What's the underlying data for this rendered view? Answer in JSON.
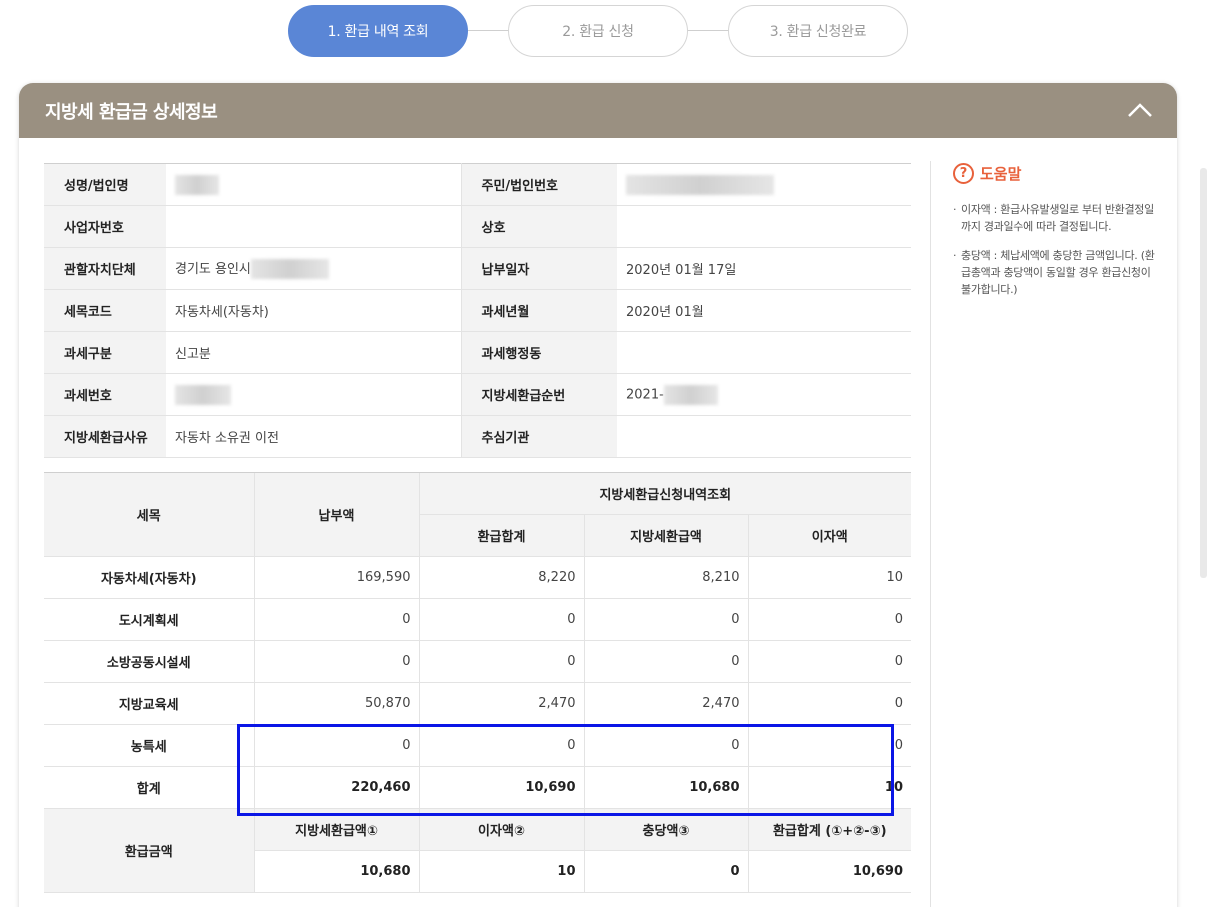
{
  "steps": [
    {
      "label": "1. 환급 내역 조회"
    },
    {
      "label": "2. 환급 신청"
    },
    {
      "label": "3. 환급 신청완료"
    }
  ],
  "panel": {
    "title": "지방세 환급금 상세정보"
  },
  "info": {
    "r1": {
      "l1": "성명/법인명",
      "l2": "주민/법인번호"
    },
    "r2": {
      "l1": "사업자번호",
      "l2": "상호"
    },
    "r3": {
      "l1": "관할자치단체",
      "v1": "경기도 용인시",
      "l2": "납부일자",
      "v2": "2020년 01월 17일"
    },
    "r4": {
      "l1": "세목코드",
      "v1": "자동차세(자동차)",
      "l2": "과세년월",
      "v2": "2020년 01월"
    },
    "r5": {
      "l1": "과세구분",
      "v1": "신고분",
      "l2": "과세행정동"
    },
    "r6": {
      "l1": "과세번호",
      "l2": "지방세환급순번",
      "v2": "2021-"
    },
    "r7": {
      "l1": "지방세환급사유",
      "v1": "자동차 소유권 이전",
      "l2": "추심기관"
    }
  },
  "amounts": {
    "h_item": "세목",
    "h_paid": "납부액",
    "h_group": "지방세환급신청내역조회",
    "h_total": "환급합계",
    "h_local": "지방세환급액",
    "h_interest": "이자액",
    "rows": [
      {
        "name": "자동차세(자동차)",
        "paid": "169,590",
        "total": "8,220",
        "local": "8,210",
        "interest": "10"
      },
      {
        "name": "도시계획세",
        "paid": "0",
        "total": "0",
        "local": "0",
        "interest": "0"
      },
      {
        "name": "소방공동시설세",
        "paid": "0",
        "total": "0",
        "local": "0",
        "interest": "0"
      },
      {
        "name": "지방교육세",
        "paid": "50,870",
        "total": "2,470",
        "local": "2,470",
        "interest": "0"
      },
      {
        "name": "농특세",
        "paid": "0",
        "total": "0",
        "local": "0",
        "interest": "0"
      },
      {
        "name": "합계",
        "paid": "220,460",
        "total": "10,690",
        "local": "10,680",
        "interest": "10"
      }
    ]
  },
  "refund": {
    "label": "환급금액",
    "h1": "지방세환급액①",
    "h2": "이자액②",
    "h3": "충당액③",
    "h4": "환급합계 (①+②-③)",
    "v1": "10,680",
    "v2": "10",
    "v3": "0",
    "v4": "10,690"
  },
  "help": {
    "icon": "question-circle-icon",
    "title": "도움말",
    "items": [
      "이자액 : 환급사유발생일로 부터 반환결정일까지 경과일수에 따라 결정됩니다.",
      "충당액 : 체납세액에 충당한 금액입니다. (환급총액과 충당액이 동일할 경우 환급신청이 불가합니다.)"
    ]
  },
  "colors": {
    "accent": "#5a86d6",
    "header": "#9a9081",
    "help": "#e8613b",
    "highlight": "#0a16e6"
  }
}
